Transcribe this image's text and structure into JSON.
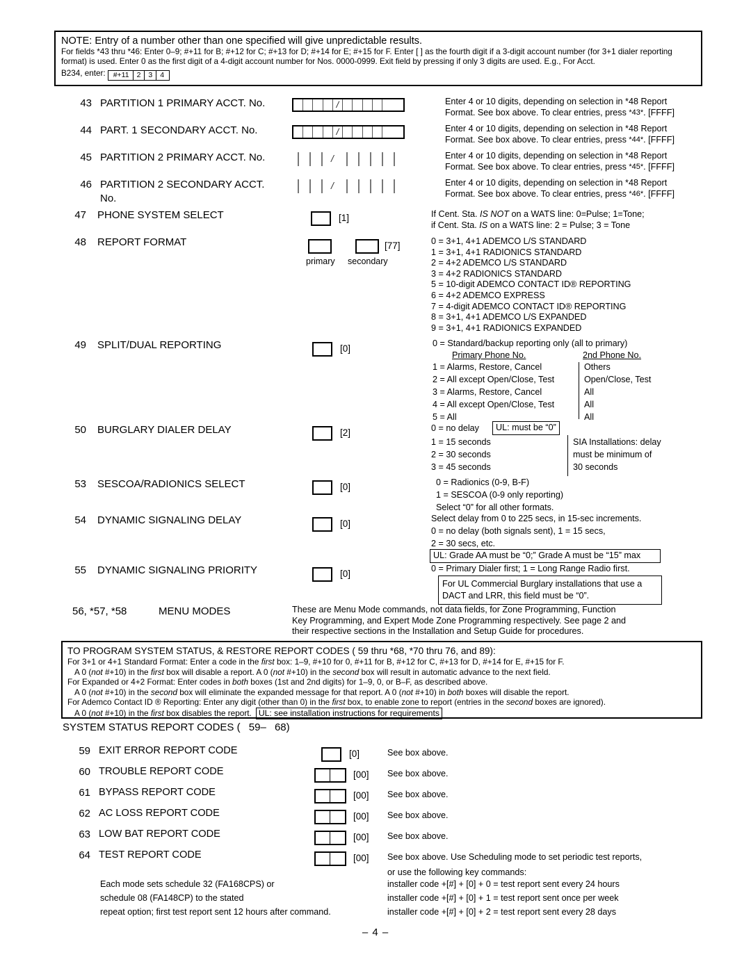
{
  "note": {
    "line1": "NOTE: Entry of a number other than one specified will give unpredictable results.",
    "line2": "For fields *43 thru *46:   Enter 0–9; #+11 for B; #+12 for C; #+13 for D; #+14 for E; #+15 for F. Enter [   ] as the fourth digit if a 3-digit account number (for 3+1 dialer reporting format) is used. Enter 0 as the first digit of a 4-digit account number for Nos. 0000-0999. Exit field by pressing    if only 3 digits are used. E.g., For Acct.",
    "line3_prefix": "B234, enter:",
    "entry_keys": [
      "#+11",
      "2",
      "3",
      "4"
    ]
  },
  "fields": {
    "f43": {
      "num": "43",
      "name": "PARTITION 1 PRIMARY ACCT. No.",
      "desc_l1": "Enter 4 or 10 digits, depending on selection in *48 Report",
      "desc_l2a": "Format. See box above. To clear entries, press ",
      "desc_l2b": "*43*",
      "desc_l2c": ". [FFFF]"
    },
    "f44": {
      "num": "44",
      "name": "PART. 1 SECONDARY ACCT. No.",
      "desc_l1": "Enter 4 or 10 digits, depending on selection in *48 Report",
      "desc_l2a": "Format. See box above. To clear entries, press ",
      "desc_l2b": "*44*",
      "desc_l2c": ". [FFFF]"
    },
    "f45": {
      "num": "45",
      "name": "PARTITION 2 PRIMARY ACCT. No.",
      "desc_l1": "Enter 4 or 10 digits, depending on selection in *48 Report",
      "desc_l2a": "Format. See box above. To clear entries, press ",
      "desc_l2b": "*45*",
      "desc_l2c": ". [FFFF]"
    },
    "f46": {
      "num": "46",
      "name": "PARTITION 2 SECONDARY ACCT.",
      "name2": "No.",
      "desc_l1": "Enter 4 or 10 digits, depending on selection in *48 Report",
      "desc_l2a": "Format. See box above. To clear entries, press ",
      "desc_l2b": "*46*",
      "desc_l2c": ". [FFFF]"
    },
    "f47": {
      "num": "47",
      "name": "PHONE SYSTEM SELECT",
      "default": "[1]",
      "desc_l1_a": "If Cent. Sta. ",
      "desc_l1_i": "IS NOT",
      "desc_l1_b": " on a WATS line: 0=Pulse; 1=Tone;",
      "desc_l2_a": "if Cent. Sta. ",
      "desc_l2_i": "IS",
      "desc_l2_b": "  on a WATS line: 2 = Pulse; 3 = Tone"
    },
    "f48": {
      "num": "48",
      "name": "REPORT FORMAT",
      "default": "[77]",
      "label_primary": "primary",
      "label_secondary": "secondary",
      "options": [
        "0 = 3+1, 4+1 ADEMCO L/S STANDARD",
        "1 = 3+1, 4+1 RADIONICS STANDARD",
        "2 = 4+2 ADEMCO L/S STANDARD",
        "3 = 4+2 RADIONICS STANDARD",
        "5 = 10-digit ADEMCO CONTACT ID® REPORTING",
        "6 = 4+2 ADEMCO EXPRESS",
        "7 = 4-digit ADEMCO CONTACT ID® REPORTING",
        "8 = 3+1, 4+1 ADEMCO L/S EXPANDED",
        "9 = 3+1, 4+1 RADIONICS EXPANDED"
      ]
    },
    "f49": {
      "num": "49",
      "name": "SPLIT/DUAL REPORTING",
      "default": "[0]",
      "desc_l1": "0 = Standard/backup reporting only (all to primary)",
      "col_head_1": "Primary Phone No.",
      "col_head_2": "2nd Phone No.",
      "rows": [
        {
          "left": "1 = Alarms, Restore, Cancel",
          "right": "Others"
        },
        {
          "left": "2 = All except Open/Close, Test",
          "right": "Open/Close, Test"
        },
        {
          "left": "3 = Alarms, Restore, Cancel",
          "right": "All"
        },
        {
          "left": "4 = All except Open/Close, Test",
          "right": "All"
        },
        {
          "left": "5 = All",
          "right": "All"
        }
      ]
    },
    "f50": {
      "num": "50",
      "name": "BURGLARY DIALER DELAY",
      "default": "[2]",
      "opt0": "0 = no delay",
      "ul_note": "UL: must be “0”",
      "opts": [
        "1 = 15 seconds",
        "2 = 30 seconds",
        "3 = 45 seconds"
      ],
      "sia": [
        "SIA Installations: delay",
        "must be minimum of",
        "30 seconds"
      ]
    },
    "f53": {
      "num": "53",
      "name": "SESCOA/RADIONICS SELECT",
      "default": "[0]",
      "opts": [
        "0 = Radionics (0-9, B-F)",
        "1 = SESCOA (0-9 only reporting)",
        "Select “0” for all other formats."
      ]
    },
    "f54": {
      "num": "54",
      "name": "DYNAMIC SIGNALING DELAY",
      "default": "[0]",
      "opts": [
        "Select delay from 0 to 225 secs, in 15-sec increments.",
        "0 = no delay (both signals sent), 1 = 15 secs,",
        "2 = 30 secs, etc."
      ],
      "ul_note": "UL: Grade AA must be “0;” Grade  A must be “15” max"
    },
    "f55": {
      "num": "55",
      "name": "DYNAMIC SIGNALING PRIORITY",
      "default": "[0]",
      "desc": "0 = Primary Dialer first; 1 = Long Range Radio first.",
      "ul_note_l1": "For UL Commercial Burglary installations that use a",
      "ul_note_l2": "DACT and LRR, this field must be “0”."
    },
    "f56": {
      "num": "56, *57, *58",
      "name": "MENU MODES",
      "desc": [
        "These are Menu Mode commands, not data fields, for Zone Programming, Function",
        "Key Programming, and Expert Mode Zone Programming respectively. See page 2 and",
        "their respective sections in the Installation and Setup Guide for procedures."
      ]
    }
  },
  "prog_box": {
    "heading_a": "TO PROGRAM SYSTEM STATUS, & RESTORE REPORT CODES (",
    "heading_b": "59 thru *68, *70 thru",
    "heading_c": "76, and",
    "heading_d": "89):",
    "l1_a": "For 3+1 or 4+1 Standard Format:   Enter a code in the ",
    "l1_i": "first",
    "l1_b": " box: 1–9, #+10 for 0, #+11 for B, #+12 for C, #+13 for D, #+14 for E, #+15 for F.",
    "l2_a": "A 0 (",
    "l2_i1": "not",
    "l2_b": " #+10) in the ",
    "l2_i2": "first",
    "l2_c": " box will disable a report. A 0 (",
    "l2_i3": "not",
    "l2_d": " #+10) in the ",
    "l2_i4": "second",
    "l2_e": " box will result in automatic advance to the next field.",
    "l3_a": "For Expanded or 4+2 Format:   Enter codes in ",
    "l3_i": "both",
    "l3_b": " boxes (1st and 2nd digits) for 1–9, 0, or B–F, as described above.",
    "l4_a": "A 0 (",
    "l4_i1": "not",
    "l4_b": " #+10) in the ",
    "l4_i2": "second",
    "l4_c": " box will eliminate the expanded message for that report. A 0 (",
    "l4_i3": "not",
    "l4_d": " #+10) in ",
    "l4_i4": "both",
    "l4_e": " boxes will disable the report.",
    "l5_a": "For Ademco Contact ID  ® Reporting:   Enter any digit (other than 0) in the ",
    "l5_i1": "first",
    "l5_b": " box, to enable zone to report (entries in the ",
    "l5_i2": "second",
    "l5_c": " boxes are ignored).",
    "l6_a": "A 0 (",
    "l6_i1": "not",
    "l6_b": " #+10) in the ",
    "l6_i2": "first",
    "l6_c": " box disables the report.",
    "l6_ul": "UL: see installation instructions for requirements"
  },
  "sys_status": {
    "header_a": "SYSTEM STATUS REPORT CODES (",
    "header_b": "59–",
    "header_c": "68)",
    "rows": [
      {
        "num": "59",
        "name": "EXIT ERROR REPORT CODE",
        "boxtype": "single",
        "default": "[0]",
        "desc": "See box above."
      },
      {
        "num": "60",
        "name": "TROUBLE REPORT CODE",
        "boxtype": "double",
        "default": "[00]",
        "desc": "See box above."
      },
      {
        "num": "61",
        "name": "BYPASS REPORT CODE",
        "boxtype": "double",
        "default": "[00]",
        "desc": "See box above."
      },
      {
        "num": "62",
        "name": "AC LOSS REPORT CODE",
        "boxtype": "double",
        "default": "[00]",
        "desc": "See box above."
      },
      {
        "num": "63",
        "name": "LOW BAT REPORT CODE",
        "boxtype": "double",
        "default": "[00]",
        "desc": "See box above."
      },
      {
        "num": "64",
        "name": "TEST REPORT CODE",
        "boxtype": "double",
        "default": "[00]",
        "desc": "See box above. Use Scheduling mode to set periodic test reports,"
      }
    ],
    "test_note_l2": "or use the following key commands:",
    "left_notes": [
      "Each mode sets schedule 32 (FA168CPS) or",
      "schedule 08 (FA148CP) to the stated",
      "repeat option; first test report sent 12 hours after command."
    ],
    "key_cmds": [
      "installer code +[#] + [0] + 0 = test report sent every 24 hours",
      "installer code +[#] + [0] + 1 = test report sent once per week",
      "installer code +[#] + [0] + 2 = test report sent every 28 days"
    ]
  },
  "footer": "– 4 –"
}
